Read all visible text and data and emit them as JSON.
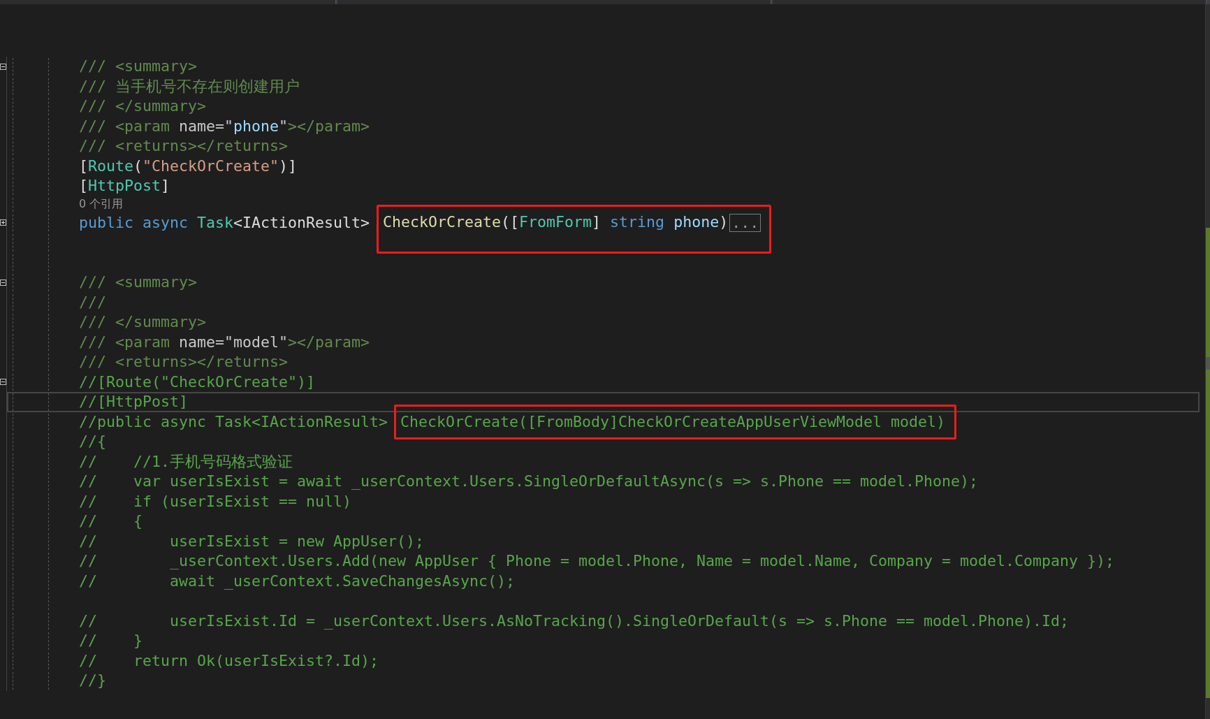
{
  "lines": [
    {
      "folded": false,
      "tokens": [
        {
          "kind": "doc",
          "text": "/// <summary>"
        }
      ]
    },
    {
      "tokens": [
        {
          "kind": "doc",
          "text": "/// 当手机号不存在则创建用户"
        }
      ]
    },
    {
      "tokens": [
        {
          "kind": "doc",
          "text": "/// </summary>"
        }
      ]
    },
    {
      "tokens": [
        {
          "kind": "doc",
          "text": "/// <param "
        },
        {
          "kind": "docattr",
          "text": "name=\""
        },
        {
          "kind": "docref",
          "text": "phone"
        },
        {
          "kind": "docattr",
          "text": "\""
        },
        {
          "kind": "doc",
          "text": "></param>"
        }
      ]
    },
    {
      "tokens": [
        {
          "kind": "doc",
          "text": "/// <returns></returns>"
        }
      ]
    },
    {
      "tokens": [
        {
          "kind": "plain",
          "text": "["
        },
        {
          "kind": "type",
          "text": "Route"
        },
        {
          "kind": "plain",
          "text": "("
        },
        {
          "kind": "string",
          "text": "\"CheckOrCreate\""
        },
        {
          "kind": "plain",
          "text": ")]"
        }
      ]
    },
    {
      "tokens": [
        {
          "kind": "plain",
          "text": "["
        },
        {
          "kind": "type",
          "text": "HttpPost"
        },
        {
          "kind": "plain",
          "text": "]"
        }
      ]
    },
    {
      "tokens": [
        {
          "kind": "codelens",
          "text": "0 个引用"
        }
      ]
    },
    {
      "folded": true,
      "tokens": [
        {
          "kind": "keyword",
          "text": "public async "
        },
        {
          "kind": "type",
          "text": "Task"
        },
        {
          "kind": "plain",
          "text": "<IActionResult> "
        }
      ],
      "boxed": [
        {
          "kind": "method",
          "text": "CheckOrCreate"
        },
        {
          "kind": "plain",
          "text": "(["
        },
        {
          "kind": "type",
          "text": "FromForm"
        },
        {
          "kind": "plain",
          "text": "] "
        },
        {
          "kind": "keyword",
          "text": "string "
        },
        {
          "kind": "param",
          "text": "phone"
        },
        {
          "kind": "plain",
          "text": ")"
        },
        {
          "kind": "collapsed",
          "text": "..."
        }
      ]
    },
    {
      "kind": "blank"
    },
    {
      "kind": "blank"
    },
    {
      "folded": false,
      "tokens": [
        {
          "kind": "doc",
          "text": "/// <summary>"
        }
      ]
    },
    {
      "tokens": [
        {
          "kind": "doc",
          "text": "///"
        }
      ]
    },
    {
      "tokens": [
        {
          "kind": "doc",
          "text": "/// </summary>"
        }
      ]
    },
    {
      "tokens": [
        {
          "kind": "doc",
          "text": "/// <param "
        },
        {
          "kind": "docattr",
          "text": "name=\"model\""
        },
        {
          "kind": "doc",
          "text": "></param>"
        }
      ]
    },
    {
      "tokens": [
        {
          "kind": "doc",
          "text": "/// <returns></returns>"
        }
      ]
    },
    {
      "folded": false,
      "tokens": [
        {
          "kind": "comment",
          "text": "//[Route(\"CheckOrCreate\")]"
        }
      ]
    },
    {
      "current": true,
      "tokens": [
        {
          "kind": "comment",
          "text": "//[HttpPost]"
        }
      ]
    },
    {
      "tokens": [
        {
          "kind": "comment",
          "text": "//public async Task<IActionResult> "
        }
      ],
      "boxed": [
        {
          "kind": "comment",
          "text": "CheckOrCreate([FromBody]CheckOrCreateAppUserViewModel model)"
        }
      ]
    },
    {
      "tokens": [
        {
          "kind": "comment",
          "text": "//{"
        }
      ]
    },
    {
      "tokens": [
        {
          "kind": "comment",
          "text": "//    //1.手机号码格式验证"
        }
      ]
    },
    {
      "tokens": [
        {
          "kind": "comment",
          "text": "//    var userIsExist = await _userContext.Users.SingleOrDefaultAsync(s => s.Phone == model.Phone);"
        }
      ]
    },
    {
      "tokens": [
        {
          "kind": "comment",
          "text": "//    if (userIsExist == null)"
        }
      ]
    },
    {
      "tokens": [
        {
          "kind": "comment",
          "text": "//    {"
        }
      ]
    },
    {
      "tokens": [
        {
          "kind": "comment",
          "text": "//        userIsExist = new AppUser();"
        }
      ]
    },
    {
      "tokens": [
        {
          "kind": "comment",
          "text": "//        _userContext.Users.Add(new AppUser { Phone = model.Phone, Name = model.Name, Company = model.Company });"
        }
      ]
    },
    {
      "tokens": [
        {
          "kind": "comment",
          "text": "//        await _userContext.SaveChangesAsync();"
        }
      ]
    },
    {
      "kind": "blank"
    },
    {
      "tokens": [
        {
          "kind": "comment",
          "text": "//        userIsExist.Id = _userContext.Users.AsNoTracking().SingleOrDefault(s => s.Phone == model.Phone).Id;"
        }
      ]
    },
    {
      "tokens": [
        {
          "kind": "comment",
          "text": "//    }"
        }
      ]
    },
    {
      "tokens": [
        {
          "kind": "comment",
          "text": "//    return Ok(userIsExist?.Id);"
        }
      ]
    },
    {
      "tokens": [
        {
          "kind": "comment",
          "text": "//}"
        }
      ]
    }
  ]
}
